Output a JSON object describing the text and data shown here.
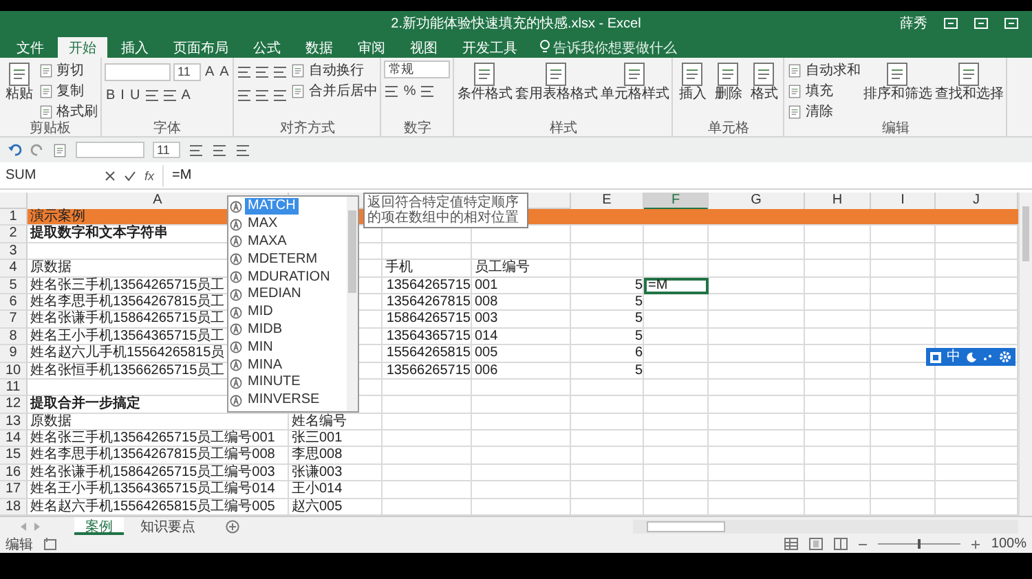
{
  "window": {
    "title": "2.新功能体验快速填充的快感.xlsx - Excel",
    "user": "薛秀"
  },
  "ribbon_tabs": [
    {
      "label": "文件",
      "selected": false
    },
    {
      "label": "开始",
      "selected": true
    },
    {
      "label": "插入",
      "selected": false
    },
    {
      "label": "页面布局",
      "selected": false
    },
    {
      "label": "公式",
      "selected": false
    },
    {
      "label": "数据",
      "selected": false
    },
    {
      "label": "审阅",
      "selected": false
    },
    {
      "label": "视图",
      "selected": false
    },
    {
      "label": "开发工具",
      "selected": false
    }
  ],
  "tell_me": "告诉我你想要做什么",
  "ribbon_groups": [
    {
      "name": "剪贴板",
      "columns": [
        [
          {
            "kind": "big",
            "label": "粘贴"
          }
        ],
        [
          {
            "kind": "small",
            "label": "剪切"
          },
          {
            "kind": "small",
            "label": "复制"
          },
          {
            "kind": "small",
            "label": "格式刷"
          }
        ]
      ]
    },
    {
      "name": "字体",
      "columns": [
        [
          {
            "kind": "row",
            "items": [
              {
                "kind": "combo"
              },
              {
                "kind": "combo-narrow",
                "value": "11"
              },
              {
                "kind": "glyph",
                "text": "A"
              },
              {
                "kind": "glyph",
                "text": "A"
              }
            ]
          },
          {
            "kind": "row",
            "items": [
              {
                "kind": "glyph",
                "text": "B"
              },
              {
                "kind": "glyph",
                "text": "I"
              },
              {
                "kind": "glyph",
                "text": "U"
              },
              {
                "kind": "tool"
              },
              {
                "kind": "tool"
              },
              {
                "kind": "glyph",
                "text": "A"
              }
            ]
          }
        ]
      ]
    },
    {
      "name": "对齐方式",
      "columns": [
        [
          {
            "kind": "row",
            "items": [
              {
                "kind": "tool"
              },
              {
                "kind": "tool"
              },
              {
                "kind": "tool"
              }
            ]
          },
          {
            "kind": "row",
            "items": [
              {
                "kind": "tool"
              },
              {
                "kind": "tool"
              },
              {
                "kind": "tool"
              }
            ]
          }
        ],
        [
          {
            "kind": "small",
            "label": "自动换行"
          },
          {
            "kind": "small",
            "label": "合并后居中"
          }
        ]
      ]
    },
    {
      "name": "数字",
      "columns": [
        [
          {
            "kind": "combo",
            "value": "常规"
          },
          {
            "kind": "row",
            "items": [
              {
                "kind": "tool"
              },
              {
                "kind": "glyph",
                "text": "%"
              },
              {
                "kind": "tool"
              }
            ]
          }
        ]
      ]
    },
    {
      "name": "样式",
      "columns": [
        [
          {
            "kind": "big",
            "label": "条件格式"
          }
        ],
        [
          {
            "kind": "big",
            "label": "套用表格格式"
          }
        ],
        [
          {
            "kind": "big",
            "label": "单元格样式"
          }
        ]
      ]
    },
    {
      "name": "单元格",
      "columns": [
        [
          {
            "kind": "big",
            "label": "插入"
          }
        ],
        [
          {
            "kind": "big",
            "label": "删除"
          }
        ],
        [
          {
            "kind": "big",
            "label": "格式"
          }
        ]
      ]
    },
    {
      "name": "编辑",
      "columns": [
        [
          {
            "kind": "small",
            "label": "自动求和"
          },
          {
            "kind": "small",
            "label": "填充"
          },
          {
            "kind": "small",
            "label": "清除"
          }
        ],
        [
          {
            "kind": "big",
            "label": "排序和筛选"
          }
        ],
        [
          {
            "kind": "big",
            "label": "查找和选择"
          }
        ]
      ]
    }
  ],
  "quick_toolbar": {
    "size": "11"
  },
  "formula_bar": {
    "name_box": "SUM",
    "fx": "fx",
    "formula": "=M"
  },
  "columns": [
    {
      "label": "A",
      "selected": false
    },
    {},
    {},
    {},
    {
      "label": "E",
      "selected": false
    },
    {
      "label": "F",
      "selected": true
    },
    {
      "label": "G",
      "selected": false
    },
    {
      "label": "H",
      "selected": false
    },
    {
      "label": "I",
      "selected": false
    },
    {
      "label": "J",
      "selected": false
    }
  ],
  "rows": [
    {
      "number": "1",
      "kind": "banner",
      "cells": [
        "演示案例"
      ]
    },
    {
      "number": "2",
      "kind": "heading",
      "cells": [
        "提取数字和文本字符串"
      ]
    },
    {
      "number": "3",
      "kind": "plain",
      "cells": []
    },
    {
      "number": "4",
      "kind": "plain",
      "cells": [
        "原数据",
        null,
        "手机",
        "员工编号"
      ]
    },
    {
      "number": "5",
      "kind": "plain",
      "cells": [
        "姓名张三手机13564265715员工",
        null,
        {
          "text": "13564265715",
          "numeric": true
        },
        "001",
        {
          "text": "5",
          "numeric": true
        },
        {
          "text": "=M",
          "active": true
        }
      ]
    },
    {
      "number": "6",
      "kind": "plain",
      "cells": [
        "姓名李思手机13564267815员工",
        null,
        {
          "text": "13564267815",
          "numeric": true
        },
        "008",
        {
          "text": "5",
          "numeric": true
        }
      ]
    },
    {
      "number": "7",
      "kind": "plain",
      "cells": [
        "姓名张谦手机15864265715员工",
        null,
        {
          "text": "15864265715",
          "numeric": true
        },
        "003",
        {
          "text": "5",
          "numeric": true
        }
      ]
    },
    {
      "number": "8",
      "kind": "plain",
      "cells": [
        "姓名王小手机13564365715员工",
        null,
        {
          "text": "13564365715",
          "numeric": true
        },
        "014",
        {
          "text": "5",
          "numeric": true
        }
      ]
    },
    {
      "number": "9",
      "kind": "plain",
      "cells": [
        "姓名赵六儿手机15564265815员",
        null,
        {
          "text": "15564265815",
          "numeric": true
        },
        "005",
        {
          "text": "6",
          "numeric": true
        }
      ]
    },
    {
      "number": "10",
      "kind": "plain",
      "cells": [
        "姓名张恒手机13566265715员工",
        null,
        {
          "text": "13566265715",
          "numeric": true
        },
        "006",
        {
          "text": "5",
          "numeric": true
        }
      ]
    },
    {
      "number": "11",
      "kind": "plain",
      "cells": []
    },
    {
      "number": "12",
      "kind": "heading",
      "cells": [
        "提取合并一步搞定"
      ]
    },
    {
      "number": "13",
      "kind": "plain",
      "cells": [
        "原数据",
        "姓名编号"
      ]
    },
    {
      "number": "14",
      "kind": "plain",
      "cells": [
        "姓名张三手机13564265715员工编号001",
        "张三001"
      ]
    },
    {
      "number": "15",
      "kind": "plain",
      "cells": [
        "姓名李思手机13564267815员工编号008",
        "李思008"
      ]
    },
    {
      "number": "16",
      "kind": "plain",
      "cells": [
        "姓名张谦手机15864265715员工编号003",
        "张谦003"
      ]
    },
    {
      "number": "17",
      "kind": "plain",
      "cells": [
        "姓名王小手机13564365715员工编号014",
        "王小014"
      ]
    },
    {
      "number": "18",
      "kind": "plain",
      "cells": [
        "姓名赵六手机15564265815员工编号005",
        "赵六005"
      ]
    }
  ],
  "autocomplete": {
    "items": [
      {
        "label": "MATCH",
        "selected": true
      },
      {
        "label": "MAX",
        "selected": false
      },
      {
        "label": "MAXA",
        "selected": false
      },
      {
        "label": "MDETERM",
        "selected": false
      },
      {
        "label": "MDURATION",
        "selected": false
      },
      {
        "label": "MEDIAN",
        "selected": false
      },
      {
        "label": "MID",
        "selected": false
      },
      {
        "label": "MIDB",
        "selected": false
      },
      {
        "label": "MIN",
        "selected": false
      },
      {
        "label": "MINA",
        "selected": false
      },
      {
        "label": "MINUTE",
        "selected": false
      },
      {
        "label": "MINVERSE",
        "selected": false
      }
    ],
    "tooltip": "返回符合特定值特定顺序的项在数组中的相对位置"
  },
  "ime": {
    "mode": "中"
  },
  "sheet_tabs": [
    {
      "label": "案例",
      "selected": true
    },
    {
      "label": "知识要点",
      "selected": false
    }
  ],
  "status_bar": {
    "mode": "编辑",
    "zoom": {
      "level": 0.5,
      "reading": "100%"
    }
  }
}
